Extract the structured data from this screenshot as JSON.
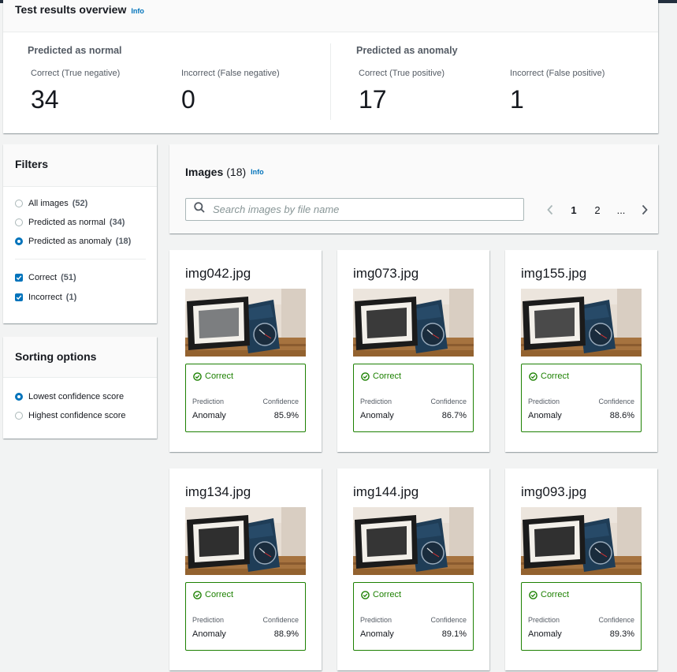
{
  "overview": {
    "title": "Test results overview",
    "info": "Info",
    "normal": {
      "title": "Predicted as normal",
      "correct_label": "Correct (True negative)",
      "correct_value": "34",
      "incorrect_label": "Incorrect (False negative)",
      "incorrect_value": "0"
    },
    "anomaly": {
      "title": "Predicted as anomaly",
      "correct_label": "Correct (True positive)",
      "correct_value": "17",
      "incorrect_label": "Incorrect (False positive)",
      "incorrect_value": "1"
    }
  },
  "filters": {
    "title": "Filters",
    "radios": [
      {
        "label": "All images",
        "count": "(52)",
        "selected": false
      },
      {
        "label": "Predicted as normal",
        "count": "(34)",
        "selected": false
      },
      {
        "label": "Predicted as anomaly",
        "count": "(18)",
        "selected": true
      }
    ],
    "checks": [
      {
        "label": "Correct",
        "count": "(51)",
        "checked": true
      },
      {
        "label": "Incorrect",
        "count": "(1)",
        "checked": true
      }
    ]
  },
  "sorting": {
    "title": "Sorting options",
    "options": [
      {
        "label": "Lowest confidence score",
        "selected": true
      },
      {
        "label": "Highest confidence score",
        "selected": false
      }
    ]
  },
  "images": {
    "title": "Images",
    "count": "(18)",
    "info": "Info",
    "search_placeholder": "Search images by file name",
    "pages": [
      "1",
      "2",
      "..."
    ],
    "current_page": "1"
  },
  "result_labels": {
    "prediction": "Prediction",
    "confidence": "Confidence"
  },
  "cards": [
    {
      "name": "img042.jpg",
      "status": "Correct",
      "prediction": "Anomaly",
      "confidence": "85.9%"
    },
    {
      "name": "img073.jpg",
      "status": "Correct",
      "prediction": "Anomaly",
      "confidence": "86.7%"
    },
    {
      "name": "img155.jpg",
      "status": "Correct",
      "prediction": "Anomaly",
      "confidence": "88.6%"
    },
    {
      "name": "img134.jpg",
      "status": "Correct",
      "prediction": "Anomaly",
      "confidence": "88.9%"
    },
    {
      "name": "img144.jpg",
      "status": "Correct",
      "prediction": "Anomaly",
      "confidence": "89.1%"
    },
    {
      "name": "img093.jpg",
      "status": "Correct",
      "prediction": "Anomaly",
      "confidence": "89.3%"
    }
  ],
  "colors": {
    "accent": "#0073bb",
    "success": "#1d8102",
    "text": "#16191f",
    "muted": "#545b64"
  }
}
